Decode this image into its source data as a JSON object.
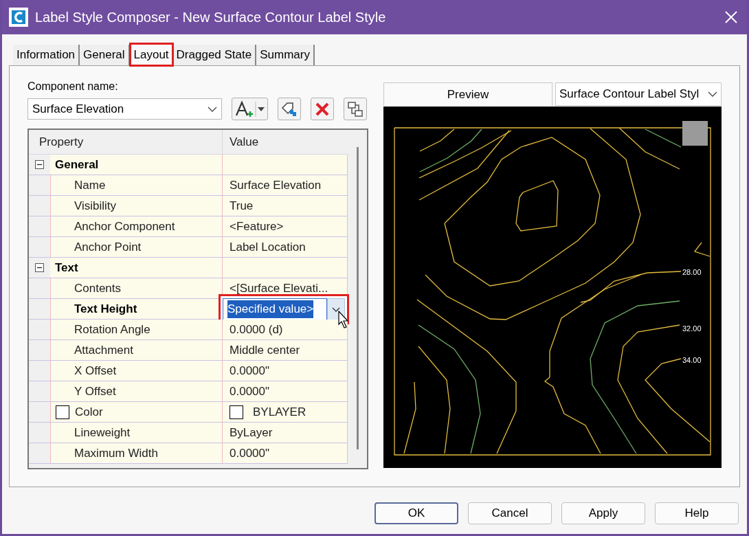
{
  "window": {
    "title": "Label Style Composer - New Surface Contour Label Style"
  },
  "tabs": [
    {
      "label": "Information",
      "selected": false
    },
    {
      "label": "General",
      "selected": false
    },
    {
      "label": "Layout",
      "selected": true,
      "highlighted": true
    },
    {
      "label": "Dragged State",
      "selected": false
    },
    {
      "label": "Summary",
      "selected": false
    }
  ],
  "component": {
    "label": "Component name:",
    "value": "Surface Elevation"
  },
  "grid": {
    "columns": [
      "Property",
      "Value"
    ],
    "groups": [
      {
        "name": "General",
        "expanded": true,
        "rows": [
          {
            "kind": "text",
            "property": "Name",
            "value": "Surface Elevation"
          },
          {
            "kind": "text",
            "property": "Visibility",
            "value": "True"
          },
          {
            "kind": "text",
            "property": "Anchor Component",
            "value": "<Feature>"
          },
          {
            "kind": "text",
            "property": "Anchor Point",
            "value": "Label Location"
          }
        ]
      },
      {
        "name": "Text",
        "expanded": true,
        "rows": [
          {
            "kind": "text",
            "property": "Contents",
            "value": "<[Surface Elevati..."
          },
          {
            "kind": "editing",
            "property": "Text Height",
            "value": "Specified value>",
            "highlighted": true
          },
          {
            "kind": "text",
            "property": "Rotation Angle",
            "value": "0.0000 (d)"
          },
          {
            "kind": "text",
            "property": "Attachment",
            "value": "Middle center"
          },
          {
            "kind": "text",
            "property": "X Offset",
            "value": "0.0000\""
          },
          {
            "kind": "text",
            "property": "Y Offset",
            "value": "0.0000\""
          },
          {
            "kind": "color",
            "property": "Color",
            "value": "BYLAYER"
          },
          {
            "kind": "text",
            "property": "Lineweight",
            "value": "ByLayer"
          },
          {
            "kind": "text",
            "property": "Maximum Width",
            "value": "0.0000\""
          }
        ]
      }
    ]
  },
  "preview": {
    "label": "Preview",
    "style": "Surface Contour Label Styl",
    "contour_labels": [
      "28.00",
      "32.00",
      "34.00"
    ]
  },
  "buttons": [
    {
      "label": "OK",
      "default": true
    },
    {
      "label": "Cancel",
      "default": false
    },
    {
      "label": "Apply",
      "default": false
    },
    {
      "label": "Help",
      "default": false
    }
  ]
}
